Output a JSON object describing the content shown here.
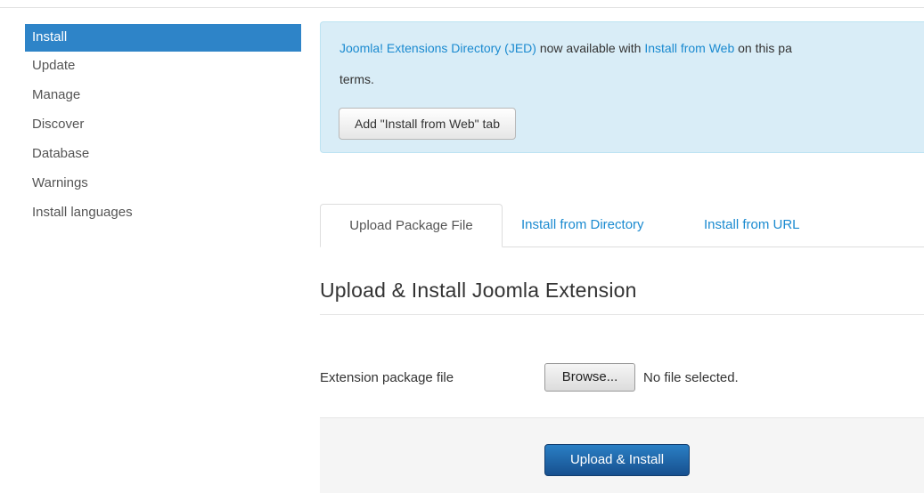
{
  "sidebar": {
    "items": [
      {
        "label": "Install",
        "active": true
      },
      {
        "label": "Update"
      },
      {
        "label": "Manage"
      },
      {
        "label": "Discover"
      },
      {
        "label": "Database"
      },
      {
        "label": "Warnings"
      },
      {
        "label": "Install languages"
      }
    ]
  },
  "jed_message": {
    "link_jed": "Joomla! Extensions Directory (JED)",
    "text_1": " now available with ",
    "link_install_web": "Install from Web",
    "text_2": " on this pa",
    "line_2": "terms.",
    "button_label": "Add \"Install from Web\" tab"
  },
  "tabs": [
    {
      "label": "Upload Package File",
      "active": true
    },
    {
      "label": "Install from Directory"
    },
    {
      "label": "Install from URL"
    }
  ],
  "main": {
    "heading": "Upload & Install Joomla Extension",
    "file_label": "Extension package file",
    "browse_label": "Browse...",
    "no_file_text": "No file selected.",
    "submit_label": "Upload & Install"
  },
  "colors": {
    "accent": "#2e84c8",
    "link": "#1a8ad0",
    "info_bg": "#d9edf7",
    "primary_button": "#17508f"
  }
}
